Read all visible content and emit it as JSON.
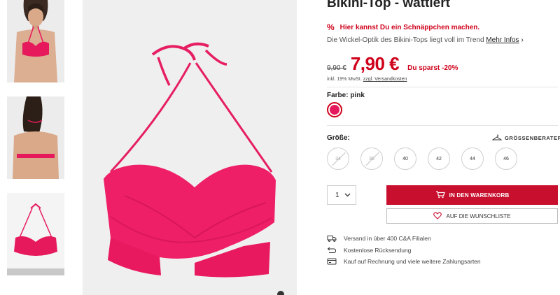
{
  "product": {
    "title": "Bikini-Top - wattiert",
    "promo_text": "Hier kannst Du ein Schnäppchen machen.",
    "description": "Die Wickel-Optik des Bikini-Tops liegt voll im Trend",
    "more_info_label": "Mehr Infos",
    "old_price": "9,90 €",
    "new_price": "7,90 €",
    "savings": "Du sparst -20%",
    "vat_text": "inkl. 19% MwSt.",
    "shipping_link": "zzgl. Versandkosten",
    "color_label": "Farbe: pink",
    "size_label": "Größe:",
    "size_guide_label": "GRÖSSENBERATER",
    "sizes": [
      {
        "label": "34",
        "available": false
      },
      {
        "label": "36",
        "available": false
      },
      {
        "label": "40",
        "available": true
      },
      {
        "label": "42",
        "available": true
      },
      {
        "label": "44",
        "available": true
      },
      {
        "label": "46",
        "available": true
      }
    ],
    "quantity": "1",
    "add_to_cart_label": "IN DEN WARENKORB",
    "wishlist_label": "AUF DIE WUNSCHLISTE",
    "features": [
      {
        "icon": "truck-icon",
        "text": "Versand in über 400 C&A Filialen"
      },
      {
        "icon": "return-icon",
        "text": "Kostenlose Rücksendung"
      },
      {
        "icon": "credit-card-icon",
        "text": "Kauf auf Rechnung und viele weitere Zahlungsarten"
      }
    ]
  },
  "colors": {
    "accent": "#d0021b",
    "button": "#c8102e",
    "product_pink": "#e6195c"
  }
}
